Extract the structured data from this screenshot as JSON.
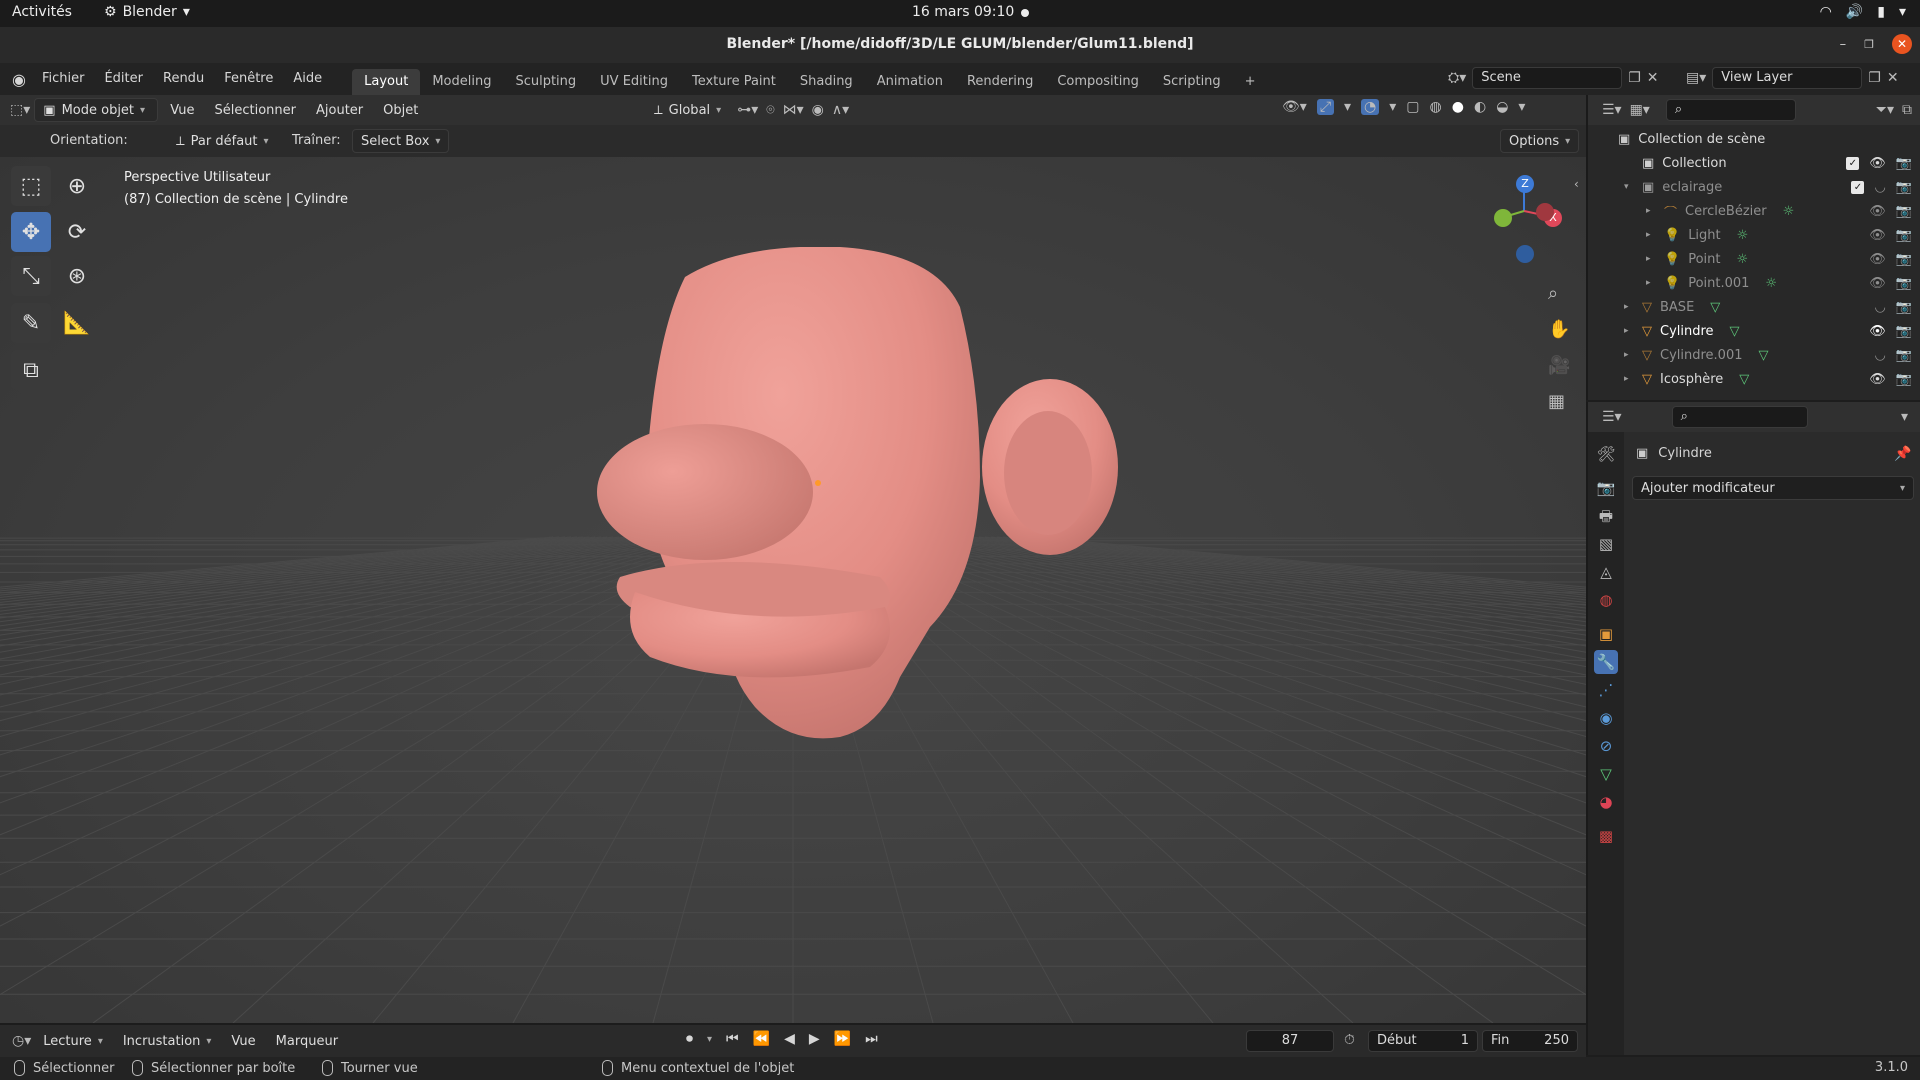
{
  "gnome": {
    "activities": "Activités",
    "app_name": "Blender",
    "clock": "16 mars  09:10"
  },
  "window": {
    "title": "Blender* [/home/didoff/3D/LE GLUM/blender/Glum11.blend]"
  },
  "menu": {
    "items": [
      "Fichier",
      "Éditer",
      "Rendu",
      "Fenêtre",
      "Aide"
    ],
    "workspaces": [
      "Layout",
      "Modeling",
      "Sculpting",
      "UV Editing",
      "Texture Paint",
      "Shading",
      "Animation",
      "Rendering",
      "Compositing",
      "Scripting"
    ],
    "active_workspace": "Layout",
    "add_tab": "+",
    "scene": "Scene",
    "view_layer": "View Layer"
  },
  "viewport_header": {
    "mode": "Mode objet",
    "menus": [
      "Vue",
      "Sélectionner",
      "Ajouter",
      "Objet"
    ],
    "orientation_value": "Global"
  },
  "tool_settings": {
    "orientation_label": "Orientation:",
    "orientation_value": "Par défaut",
    "drag_label": "Traîner:",
    "drag_value": "Select Box",
    "options": "Options"
  },
  "viewport": {
    "view_name": "Perspective Utilisateur",
    "context": "(87) Collection de scène | Cylindre",
    "gizmo": {
      "z": "Z",
      "x": "X"
    }
  },
  "outliner": {
    "root": "Collection de scène",
    "rows": [
      {
        "label": "Collection",
        "indent": 1,
        "icon": "collection",
        "dim": false
      },
      {
        "label": "eclairage",
        "indent": 1,
        "icon": "collection",
        "dim": true
      },
      {
        "label": "CercleBézier",
        "indent": 2,
        "icon": "curve",
        "dim": true
      },
      {
        "label": "Light",
        "indent": 2,
        "icon": "light",
        "dim": true
      },
      {
        "label": "Point",
        "indent": 2,
        "icon": "light",
        "dim": true
      },
      {
        "label": "Point.001",
        "indent": 2,
        "icon": "light",
        "dim": true
      },
      {
        "label": "BASE",
        "indent": 1,
        "icon": "mesh",
        "dim": true
      },
      {
        "label": "Cylindre",
        "indent": 1,
        "icon": "mesh",
        "dim": false
      },
      {
        "label": "Cylindre.001",
        "indent": 1,
        "icon": "mesh",
        "dim": true
      },
      {
        "label": "Icosphère",
        "indent": 1,
        "icon": "mesh",
        "dim": false
      }
    ]
  },
  "properties": {
    "object_name": "Cylindre",
    "add_modifier": "Ajouter modificateur"
  },
  "timeline": {
    "menus": [
      "Lecture",
      "Incrustation",
      "Vue",
      "Marqueur"
    ],
    "current_frame": "87",
    "start_label": "Début",
    "start_value": "1",
    "end_label": "Fin",
    "end_value": "250"
  },
  "status": {
    "select": "Sélectionner",
    "box_select": "Sélectionner par boîte",
    "rotate_view": "Tourner vue",
    "context_menu": "Menu contextuel de l'objet",
    "version": "3.1.0"
  },
  "colors": {
    "accent": "#4772b3",
    "head": "#e8938b",
    "mesh_icon": "#e39a3b",
    "data_icon": "#5ec77a"
  }
}
